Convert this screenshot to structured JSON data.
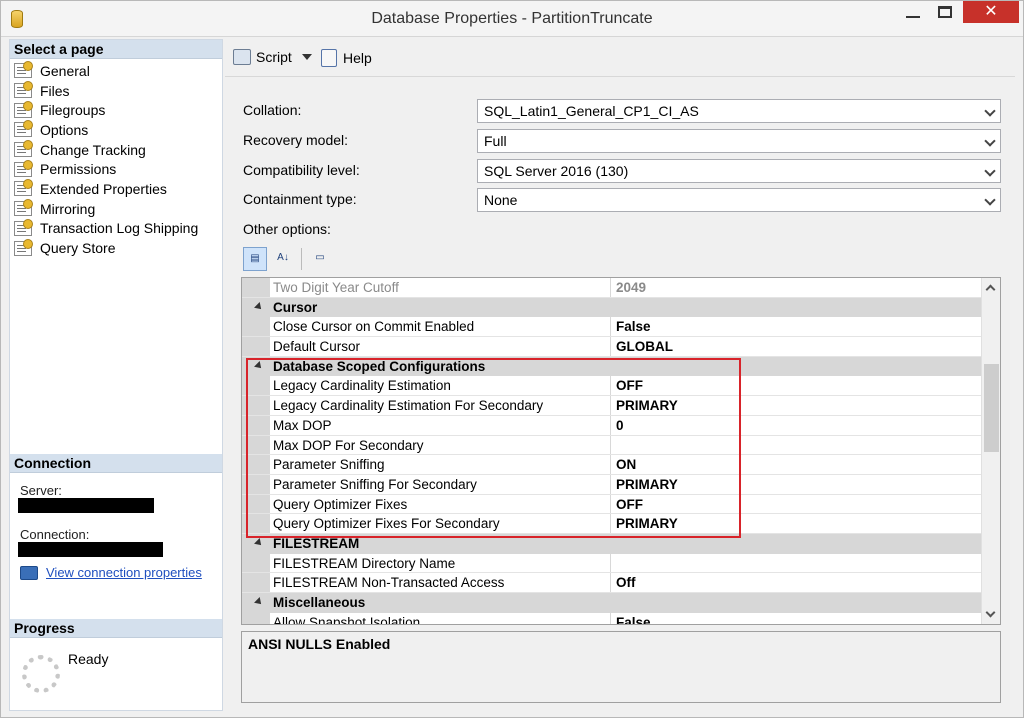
{
  "window": {
    "title": "Database Properties - PartitionTruncate",
    "close_glyph": "✕"
  },
  "left": {
    "select_page_header": "Select a page",
    "pages": [
      "General",
      "Files",
      "Filegroups",
      "Options",
      "Change Tracking",
      "Permissions",
      "Extended Properties",
      "Mirroring",
      "Transaction Log Shipping",
      "Query Store"
    ],
    "connection_header": "Connection",
    "server_label": "Server:",
    "connection_label": "Connection:",
    "view_connection_link": "View connection properties",
    "progress_header": "Progress",
    "progress_status": "Ready"
  },
  "toolbar": {
    "script_label": "Script",
    "help_label": "Help"
  },
  "form": {
    "collation_label": "Collation:",
    "collation_value": "SQL_Latin1_General_CP1_CI_AS",
    "recovery_label": "Recovery model:",
    "recovery_value": "Full",
    "compat_label": "Compatibility level:",
    "compat_value": "SQL Server 2016 (130)",
    "containment_label": "Containment type:",
    "containment_value": "None",
    "other_options_label": "Other options:"
  },
  "grid": {
    "rows": [
      {
        "kind": "item",
        "name": "Two Digit Year Cutoff",
        "value": "2049",
        "dim": true
      },
      {
        "kind": "cat",
        "name": "Cursor"
      },
      {
        "kind": "item",
        "name": "Close Cursor on Commit Enabled",
        "value": "False"
      },
      {
        "kind": "item",
        "name": "Default Cursor",
        "value": "GLOBAL"
      },
      {
        "kind": "cat",
        "name": "Database Scoped Configurations"
      },
      {
        "kind": "item",
        "name": "Legacy Cardinality Estimation",
        "value": "OFF"
      },
      {
        "kind": "item",
        "name": "Legacy Cardinality Estimation For Secondary",
        "value": "PRIMARY"
      },
      {
        "kind": "item",
        "name": "Max DOP",
        "value": "0"
      },
      {
        "kind": "item",
        "name": "Max DOP For Secondary",
        "value": ""
      },
      {
        "kind": "item",
        "name": "Parameter Sniffing",
        "value": "ON"
      },
      {
        "kind": "item",
        "name": "Parameter Sniffing For Secondary",
        "value": "PRIMARY"
      },
      {
        "kind": "item",
        "name": "Query Optimizer Fixes",
        "value": "OFF"
      },
      {
        "kind": "item",
        "name": "Query Optimizer Fixes For Secondary",
        "value": "PRIMARY"
      },
      {
        "kind": "cat",
        "name": "FILESTREAM"
      },
      {
        "kind": "item",
        "name": "FILESTREAM Directory Name",
        "value": ""
      },
      {
        "kind": "item",
        "name": "FILESTREAM Non-Transacted Access",
        "value": "Off"
      },
      {
        "kind": "cat",
        "name": "Miscellaneous"
      },
      {
        "kind": "item",
        "name": "Allow Snapshot Isolation",
        "value": "False"
      }
    ],
    "description_title": "ANSI NULLS Enabled",
    "highlight_color": "#d8232a"
  }
}
